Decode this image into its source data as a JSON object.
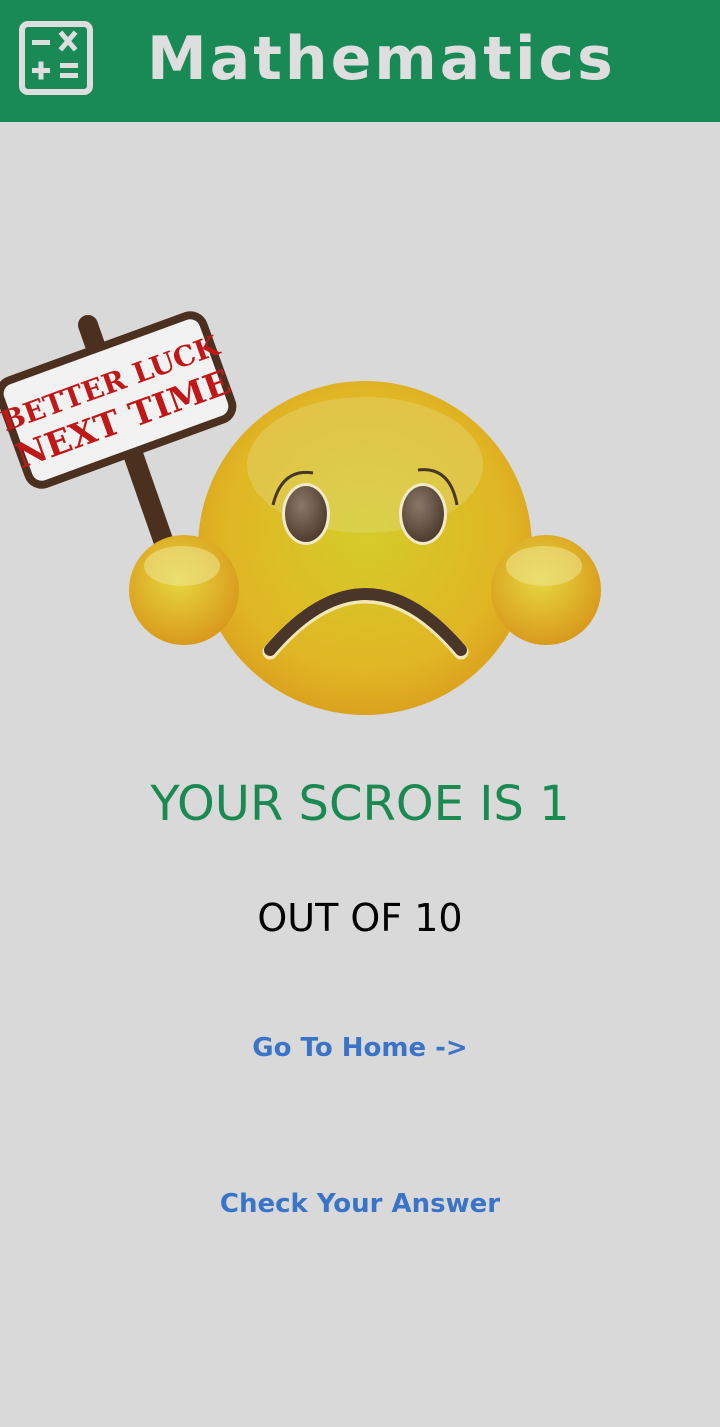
{
  "appbar": {
    "title": "Mathematics",
    "icon": "calculator-icon",
    "background": "#198a56"
  },
  "illustration": {
    "sign_line_1": "BETTER LUCK",
    "sign_line_2": "NEXT TIME",
    "icon": "sad-emoji-icon"
  },
  "result": {
    "score_text": "YOUR SCROE IS 1",
    "out_of_text": "OUT OF 10",
    "score_color": "#1a8a52"
  },
  "actions": {
    "home_label": "Go To Home ->",
    "check_label": "Check Your Answer",
    "link_color": "#3a74c9"
  }
}
